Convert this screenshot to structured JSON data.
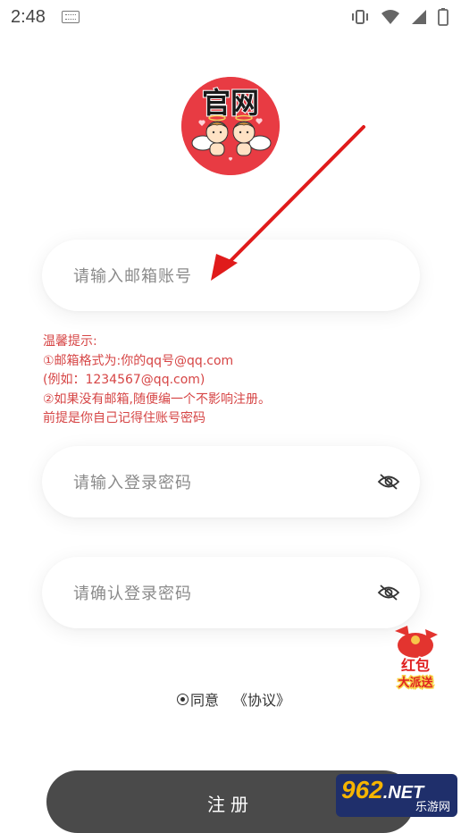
{
  "status_bar": {
    "time": "2:48"
  },
  "logo": {
    "text": "官网",
    "colors": {
      "background": "#e83b43",
      "text": "#1a1a1a"
    }
  },
  "form": {
    "email_placeholder": "请输入邮箱账号",
    "tips": [
      "温馨提示:",
      "①邮箱格式为:你的qq号@qq.com",
      "(例如：1234567@qq.com)",
      "②如果没有邮箱,随便编一个不影响注册。",
      "前提是你自己记得住账号密码"
    ],
    "password_placeholder": "请输入登录密码",
    "confirm_placeholder": "请确认登录密码",
    "agree_label": "同意",
    "agreement_link": "《协议》",
    "submit_label": "注册"
  },
  "badge": {
    "line1": "红包",
    "line2": "大派送"
  },
  "watermark": {
    "brand": "962",
    "suffix": ".NET",
    "sub": "乐游网"
  },
  "colors": {
    "tip_red": "#d64545",
    "button_gray": "#4a4a4a",
    "arrow_red": "#e01b1b"
  }
}
